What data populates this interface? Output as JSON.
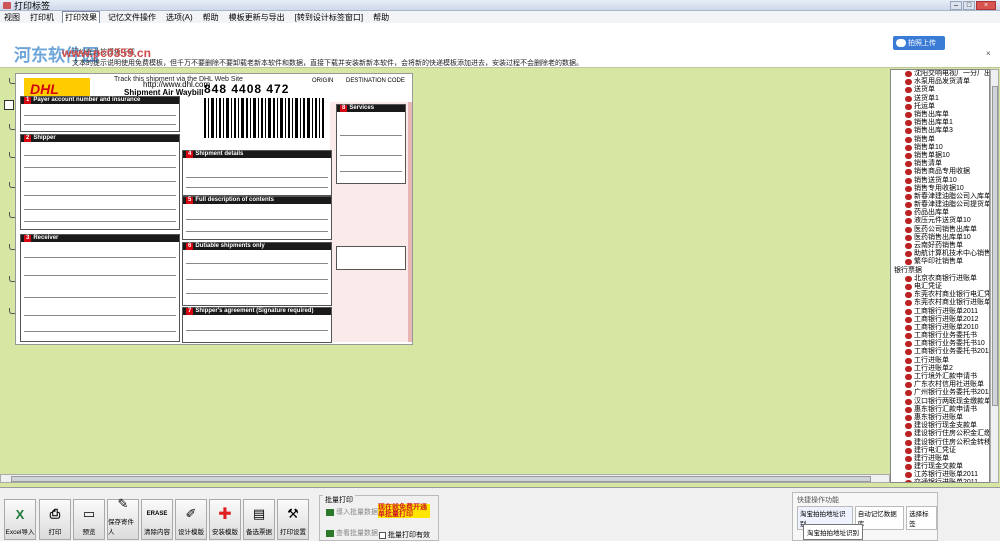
{
  "window": {
    "title": "打印标签"
  },
  "menu": [
    "视图",
    "打印机",
    "打印效果",
    "记忆文件操作",
    "选项(A)",
    "帮助",
    "模板更新与导出",
    "[转到设计标签窗口]",
    "帮助"
  ],
  "menu_active_index": 2,
  "info": {
    "watermark": "河东软件园",
    "watermark_url": "www.pc0359.cn",
    "notice_top": "可以在此按模板下载",
    "notice": "文本的提示说明使用免费模板，但千万不要删除不要卸载老新本软件和数据，直接下载并安装新新本软件，会将新的快递模板添加进去，安装过程不会删除老的数据。",
    "cloud_label": "拍照上传",
    "close": "×"
  },
  "waybill": {
    "logo": "DHL",
    "track_text": "Track this shipment via the DHL Web Site",
    "url": "http://www.dhl.com",
    "title": "Shipment Air Waybill",
    "number": "848 4408 472",
    "origin": "ORIGIN",
    "destination": "DESTINATION CODE",
    "sections": [
      {
        "num": "1",
        "label": "Payer account number and insurance"
      },
      {
        "num": "2",
        "label": "Shipper"
      },
      {
        "num": "3",
        "label": "Receiver"
      },
      {
        "num": "4",
        "label": "Shipment details"
      },
      {
        "num": "5",
        "label": "Full description of contents"
      },
      {
        "num": "6",
        "label": "Dutiable shipments only"
      },
      {
        "num": "7",
        "label": "Shipper's agreement (Signature required)"
      },
      {
        "num": "8",
        "label": "Services"
      }
    ]
  },
  "template_list": {
    "items": [
      {
        "label": "沈阳交响电视厂一分厂出库单",
        "level": "item"
      },
      {
        "label": "水泵用品发货清单",
        "level": "item"
      },
      {
        "label": "送货单",
        "level": "item"
      },
      {
        "label": "送货单1",
        "level": "item"
      },
      {
        "label": "托运单",
        "level": "item"
      },
      {
        "label": "销售出库单",
        "level": "item"
      },
      {
        "label": "销售出库单1",
        "level": "item"
      },
      {
        "label": "销售出库单3",
        "level": "item"
      },
      {
        "label": "销售单",
        "level": "item"
      },
      {
        "label": "销售单10",
        "level": "item"
      },
      {
        "label": "销售单据10",
        "level": "item"
      },
      {
        "label": "销售清单",
        "level": "item"
      },
      {
        "label": "销售商品专用收据",
        "level": "item"
      },
      {
        "label": "销售送货单10",
        "level": "item"
      },
      {
        "label": "销售专用收据10",
        "level": "item"
      },
      {
        "label": "新春津建油脂公司入库单",
        "level": "item"
      },
      {
        "label": "新春津建油脂公司提货单",
        "level": "item"
      },
      {
        "label": "药品出库单",
        "level": "item"
      },
      {
        "label": "液压元件送货单10",
        "level": "item"
      },
      {
        "label": "医药公司销售出库单",
        "level": "item"
      },
      {
        "label": "医药销售出库单10",
        "level": "item"
      },
      {
        "label": "云南好药销售单",
        "level": "item"
      },
      {
        "label": "助航计算机技术中心销售收",
        "level": "item"
      },
      {
        "label": "繁华印社销售单",
        "level": "item"
      },
      {
        "label": "银行票据",
        "level": "root"
      },
      {
        "label": "北京农商银行进账单",
        "level": "item"
      },
      {
        "label": "电汇凭证",
        "level": "item"
      },
      {
        "label": "东莞农村商业银行电汇凭证",
        "level": "item"
      },
      {
        "label": "东莞农村商业银行进账单",
        "level": "item"
      },
      {
        "label": "工商银行进账单2011",
        "level": "item"
      },
      {
        "label": "工商银行进账单2012",
        "level": "item"
      },
      {
        "label": "工商银行进账单2010",
        "level": "item"
      },
      {
        "label": "工商银行业务委托书",
        "level": "item"
      },
      {
        "label": "工商银行业务委托书10",
        "level": "item"
      },
      {
        "label": "工商银行业务委托书2011",
        "level": "item"
      },
      {
        "label": "工行进账单",
        "level": "item"
      },
      {
        "label": "工行进账单2",
        "level": "item"
      },
      {
        "label": "工行境外汇款申请书",
        "level": "item"
      },
      {
        "label": "广东农村信用社进账单",
        "level": "item"
      },
      {
        "label": "广州银行业务委托书2011",
        "level": "item"
      },
      {
        "label": "汉口银行两联现金缴款单",
        "level": "item"
      },
      {
        "label": "惠东银行汇款申请书",
        "level": "item"
      },
      {
        "label": "惠东银行进账单",
        "level": "item"
      },
      {
        "label": "建设银行现金支款单",
        "level": "item"
      },
      {
        "label": "建设银行住房公积金汇缴书",
        "level": "item"
      },
      {
        "label": "建设银行住房公积金转移通",
        "level": "item"
      },
      {
        "label": "建行电汇凭证",
        "level": "item"
      },
      {
        "label": "建行进账单",
        "level": "item"
      },
      {
        "label": "建行现金交款单",
        "level": "item"
      },
      {
        "label": "江苏银行进账单2011",
        "level": "item"
      },
      {
        "label": "交通银行进账单2011",
        "level": "item"
      }
    ]
  },
  "toolbar": {
    "buttons": [
      {
        "label": "Excel导入",
        "icon": "excel-icon"
      },
      {
        "label": "打印",
        "icon": "printer-icon"
      },
      {
        "label": "预览",
        "icon": "monitor-icon"
      },
      {
        "label": "保存寄件人",
        "icon": "pen-save-icon"
      },
      {
        "label": "清除内容",
        "icon": "erase-icon"
      },
      {
        "label": "设计模版",
        "icon": "pencil-icon"
      },
      {
        "label": "安装模版",
        "icon": "red-cross-icon"
      },
      {
        "label": "备选票据",
        "icon": "documents-icon"
      },
      {
        "label": "打印设置",
        "icon": "wrench-icon"
      }
    ],
    "erase_text": "ERASE",
    "batch": {
      "label": "批量打印",
      "import_label": "導入批量数据",
      "edit_label": "查看批量数据",
      "red_note": "现在就免费开通单批量打印",
      "checkbox_label": "批量打印有效"
    },
    "quick": {
      "title": "快捷操作功能",
      "tabs": [
        "淘宝拍拍地址识别",
        "自动记忆数据库",
        "选择标签"
      ],
      "action": "淘宝拍拍地址识别"
    }
  }
}
